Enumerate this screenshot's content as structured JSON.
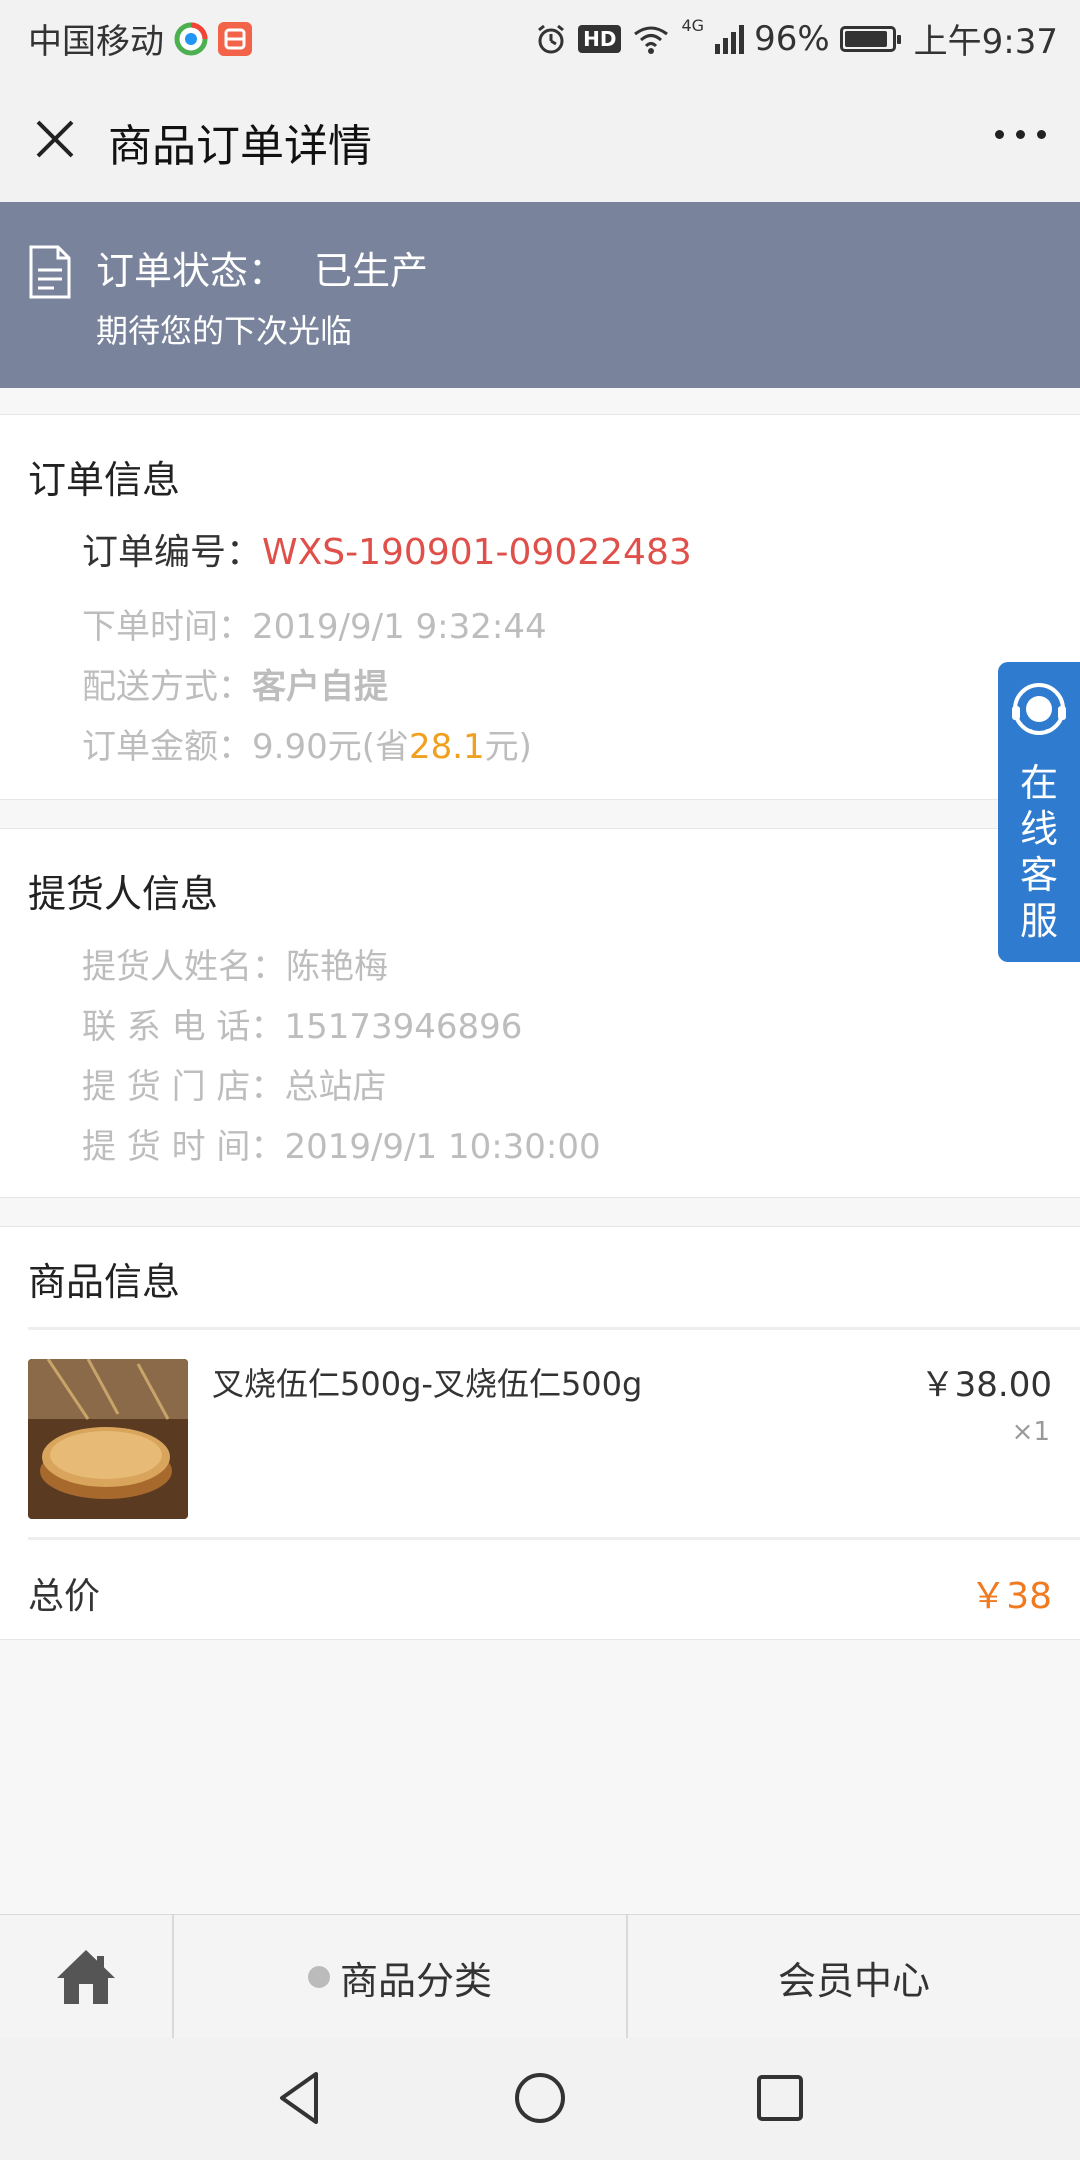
{
  "status_bar": {
    "carrier": "中国移动",
    "network": "4G",
    "battery": "96%",
    "battery_level": 0.96,
    "time": "上午9:37",
    "hd_label": "HD"
  },
  "header": {
    "title": "商品订单详情"
  },
  "order_status": {
    "label": "订单状态：",
    "value": "已生产",
    "subtitle": "期待您的下次光临"
  },
  "order_info": {
    "title": "订单信息",
    "number_label": "订单编号：",
    "number_value": "WXS-190901-09022483",
    "time_label": "下单时间：",
    "time_value": "2019/9/1 9:32:44",
    "delivery_label": "配送方式：",
    "delivery_value": "客户自提",
    "amount_label": "订单金额：",
    "amount_value": "9.90元(省",
    "amount_saved": "28.1",
    "amount_suffix": "元)"
  },
  "pickup_info": {
    "title": "提货人信息",
    "name_label": "提货人姓名：",
    "name_value": "陈艳梅",
    "phone_label": "联 系 电 话：",
    "phone_value": "15173946896",
    "store_label": "提 货 门 店：",
    "store_value": "总站店",
    "time_label": "提 货 时 间：",
    "time_value": "2019/9/1 10:30:00"
  },
  "product_info": {
    "title": "商品信息",
    "items": [
      {
        "name": "叉烧伍仁500g-叉烧伍仁500g",
        "price": "￥38.00",
        "qty": "×1"
      }
    ],
    "total_label": "总价",
    "total_value": "￥38"
  },
  "service": {
    "label": "在线客服"
  },
  "bottom_nav": {
    "category": "商品分类",
    "member": "会员中心"
  },
  "colors": {
    "banner": "#79849c",
    "order_number": "#e0504a",
    "saved": "#f0a020",
    "total": "#f07a20",
    "service": "#2e7bcf"
  }
}
